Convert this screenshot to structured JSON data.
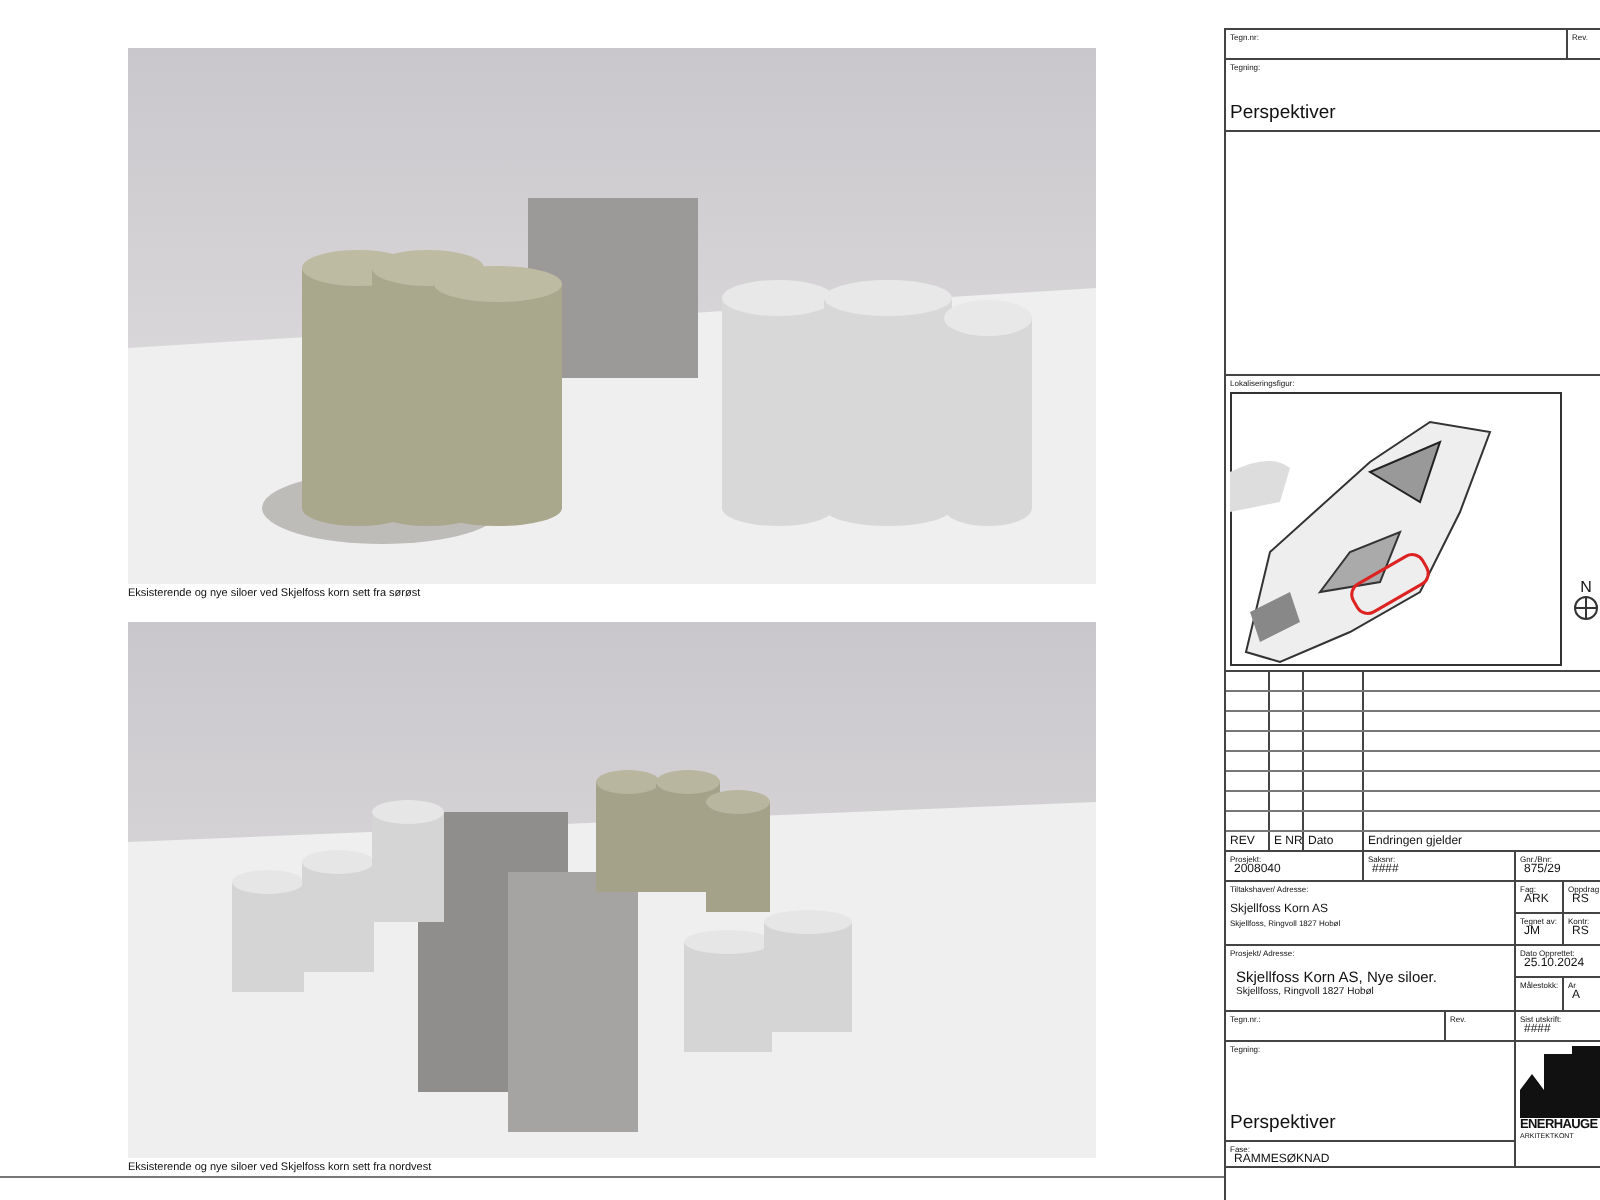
{
  "views": [
    {
      "caption": "Eksisterende og nye siloer ved Skjelfoss korn sett fra sørøst"
    },
    {
      "caption": "Eksisterende og nye siloer ved Skjelfoss korn sett fra nordvest"
    }
  ],
  "title_block": {
    "top": {
      "drawing_no_label": "Tegn.nr:",
      "rev_label": "Rev.",
      "drawing_label": "Tegning:",
      "drawing_title": "Perspektiver"
    },
    "location": {
      "label": "Lokaliseringsfigur:",
      "north_label": "N"
    },
    "revisions": {
      "columns": [
        "REV",
        "E NR",
        "Dato",
        "Endringen gjelder"
      ]
    },
    "project": {
      "label": "Prosjekt:",
      "value": "2008040"
    },
    "case": {
      "label": "Saksnr:",
      "value": "####"
    },
    "parcel": {
      "label": "Gnr./Bnr:",
      "value": "875/29"
    },
    "client": {
      "label": "Tiltakshaver/ Adresse:",
      "name": "Skjellfoss Korn AS",
      "address": "Skjellfoss, Ringvoll 1827 Hobøl"
    },
    "discipline": {
      "label": "Fag:",
      "value": "ARK"
    },
    "responsible": {
      "label": "Oppdrag",
      "value": "RS"
    },
    "drawn_by": {
      "label": "Tegnet av:",
      "value": "JM"
    },
    "checked_by": {
      "label": "Kontr:",
      "value": "RS"
    },
    "project_address": {
      "label": "Prosjekt/ Adresse:",
      "name": "Skjellfoss Korn AS, Nye siloer.",
      "address": "Skjellfoss, Ringvoll 1827 Hobøl"
    },
    "created": {
      "label": "Dato Opprettet:",
      "value": "25.10.2024"
    },
    "scale": {
      "label": "Målestokk:"
    },
    "format": {
      "label": "Ar",
      "value": "A"
    },
    "bottom_drawing_no": {
      "label": "Tegn.nr.:"
    },
    "bottom_rev": {
      "label": "Rev."
    },
    "last_print": {
      "label": "Sist utskrift:",
      "value": "####"
    },
    "bottom_drawing": {
      "label": "Tegning:",
      "title": "Perspektiver"
    },
    "phase": {
      "label": "Fase:",
      "value": "RAMMESØKNAD"
    },
    "logo": {
      "name": "ENERHAUGE",
      "subtitle": "ARKITEKTKONT"
    }
  }
}
